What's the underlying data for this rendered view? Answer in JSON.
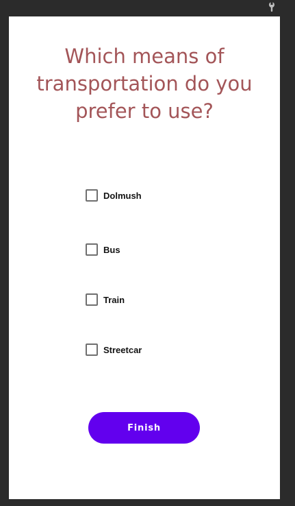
{
  "question": {
    "text": "Which means of transportation do you prefer to use?"
  },
  "options": [
    {
      "label": "Dolmush",
      "checked": false
    },
    {
      "label": "Bus",
      "checked": false
    },
    {
      "label": "Train",
      "checked": false
    },
    {
      "label": "Streetcar",
      "checked": false
    }
  ],
  "finish_button": {
    "label": "Finish"
  },
  "status_bar": {
    "icon": "wrench-icon"
  },
  "colors": {
    "question_text": "#a35558",
    "button_background": "#6200ee",
    "button_text": "#ffffff",
    "checkbox_border": "#6f6f6f",
    "background": "#2b2b2b"
  }
}
